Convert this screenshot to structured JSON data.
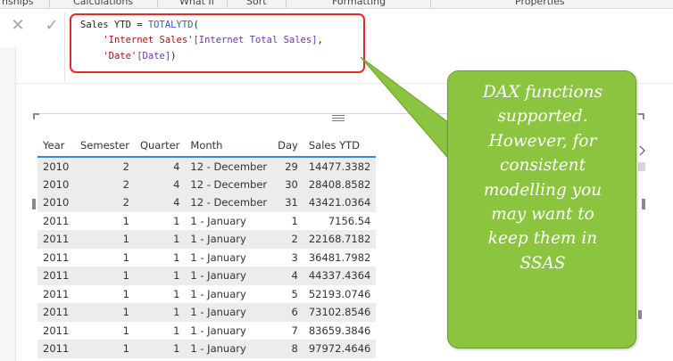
{
  "ribbon": {
    "groups": [
      "nships",
      "Calculations",
      "What If",
      "Sort",
      "Formatting",
      "Properties"
    ]
  },
  "formula_bar": {
    "cancel_icon": "close-icon",
    "commit_icon": "check-icon",
    "line1_measure": "Sales YTD = ",
    "line1_fn": "TOTALYTD",
    "line1_paren": "(",
    "line2_table": "'Internet Sales'",
    "line2_column": "[Internet Total Sales]",
    "line2_end": ",",
    "line3_table": "'Date'",
    "line3_column": "[Date]",
    "line3_end": ")"
  },
  "table": {
    "headers": [
      "Year",
      "Semester",
      "Quarter",
      "Month",
      "Day",
      "Sales YTD"
    ],
    "rows": [
      [
        "2010",
        "2",
        "4",
        "12 - December",
        "29",
        "14477.3382"
      ],
      [
        "2010",
        "2",
        "4",
        "12 - December",
        "30",
        "28408.8582"
      ],
      [
        "2010",
        "2",
        "4",
        "12 - December",
        "31",
        "43421.0364"
      ],
      [
        "2011",
        "1",
        "1",
        "1 - January",
        "1",
        "7156.54"
      ],
      [
        "2011",
        "1",
        "1",
        "1 - January",
        "2",
        "22168.7182"
      ],
      [
        "2011",
        "1",
        "1",
        "1 - January",
        "3",
        "36481.7982"
      ],
      [
        "2011",
        "1",
        "1",
        "1 - January",
        "4",
        "44337.4364"
      ],
      [
        "2011",
        "1",
        "1",
        "1 - January",
        "5",
        "52193.0746"
      ],
      [
        "2011",
        "1",
        "1",
        "1 - January",
        "6",
        "73102.8546"
      ],
      [
        "2011",
        "1",
        "1",
        "1 - January",
        "7",
        "83659.3846"
      ],
      [
        "2011",
        "1",
        "1",
        "1 - January",
        "8",
        "97972.4646"
      ]
    ]
  },
  "callout": {
    "lines": [
      "DAX functions",
      "supported.",
      "However, for",
      "consistent",
      "modelling you",
      "may want to",
      "keep them in",
      "SSAS"
    ]
  },
  "colors": {
    "highlight_border": "#e12a2a",
    "callout_fill": "#8bc53f",
    "header_rule": "#2d8fcf",
    "alt_row": "#ececec"
  }
}
